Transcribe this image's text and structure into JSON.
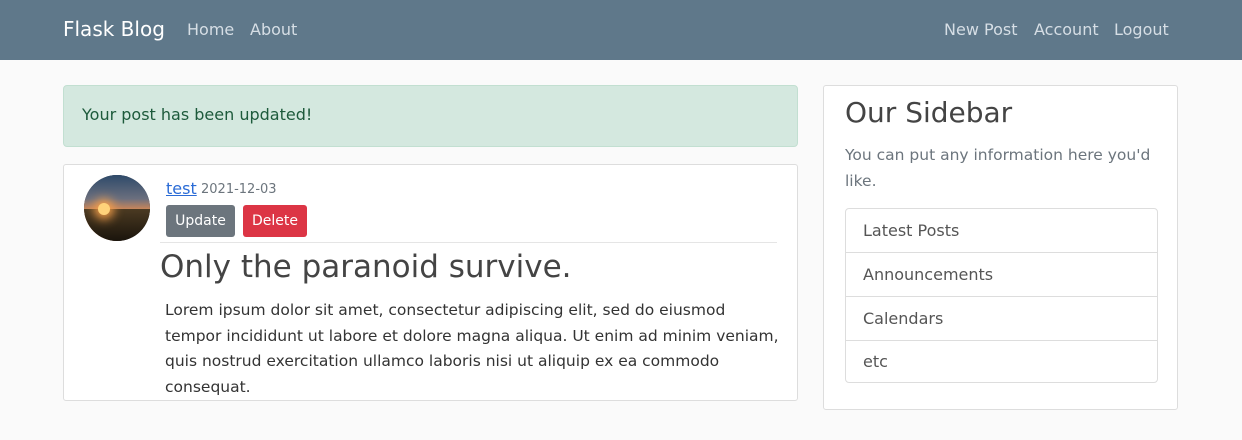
{
  "navbar": {
    "brand": "Flask Blog",
    "left_links": [
      "Home",
      "About"
    ],
    "right_links": [
      "New Post",
      "Account",
      "Logout"
    ]
  },
  "alert": {
    "message": "Your post has been updated!"
  },
  "post": {
    "author": "test",
    "date": "2021-12-03",
    "update_label": "Update",
    "delete_label": "Delete",
    "title": "Only the paranoid survive.",
    "content": "Lorem ipsum dolor sit amet, consectetur adipiscing elit, sed do eiusmod tempor incididunt ut labore et dolore magna aliqua. Ut enim ad minim veniam, quis nostrud exercitation ullamco laboris nisi ut aliquip ex ea commodo consequat."
  },
  "sidebar": {
    "title": "Our Sidebar",
    "text": "You can put any information here you'd like.",
    "items": [
      "Latest Posts",
      "Announcements",
      "Calendars",
      "etc"
    ]
  },
  "colors": {
    "navbar": "#5f788a",
    "alert_bg": "#d4e8df",
    "update_button": "#6c757d",
    "delete_button": "#dc3545",
    "link": "#2a6bd6"
  }
}
